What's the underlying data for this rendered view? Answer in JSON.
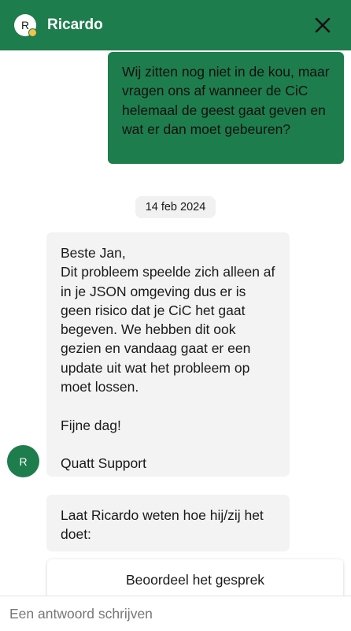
{
  "header": {
    "avatar_initial": "R",
    "name": "Ricardo",
    "close_label": "Close"
  },
  "messages": {
    "outgoing_text": "Wij zitten nog niet in de kou, maar vragen ons af wanneer de CiC helemaal de geest gaat geven en wat er dan moet gebeuren?",
    "date": "14 feb 2024",
    "incoming_text": "Beste Jan,\nDit probleem speelde zich alleen af in je JSON omgeving dus er is geen risico dat je CiC het gaat begeven. We hebben dit ook gezien en vandaag gaat er een update uit wat het probleem op moet lossen.\n\nFijne dag!\n\nQuatt Support",
    "agent_initial": "R",
    "rating_prompt": "Laat Ricardo weten hoe hij/zij het doet:",
    "rating_button": "Beoordeel het gesprek"
  },
  "composer": {
    "placeholder": "Een antwoord schrijven"
  },
  "colors": {
    "brand_green": "#1e7d4c",
    "status_dot": "#f6c343",
    "bubble_grey": "#f3f3f3"
  },
  "icons": {
    "close": "close-icon",
    "status": "online-status-dot"
  }
}
